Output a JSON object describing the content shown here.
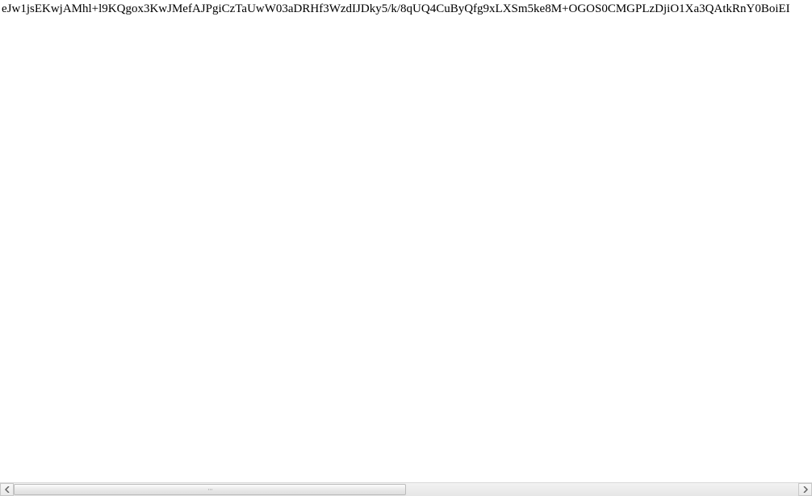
{
  "content": {
    "text": "eJw1jsEKwjAMhl+l9KQgox3KwJMefAJPgiCzTaUwW03aDRHf3WzdIJDky5/k/8qUQ4CuByQfg9xLXSm5ke8M+OGOS0CMGPLzDjiO1Xa3QAtkRnY0BoiEI"
  },
  "scrollbar": {
    "thumb_width_percent": 50,
    "thumb_left_percent": 0,
    "grip": "···"
  }
}
